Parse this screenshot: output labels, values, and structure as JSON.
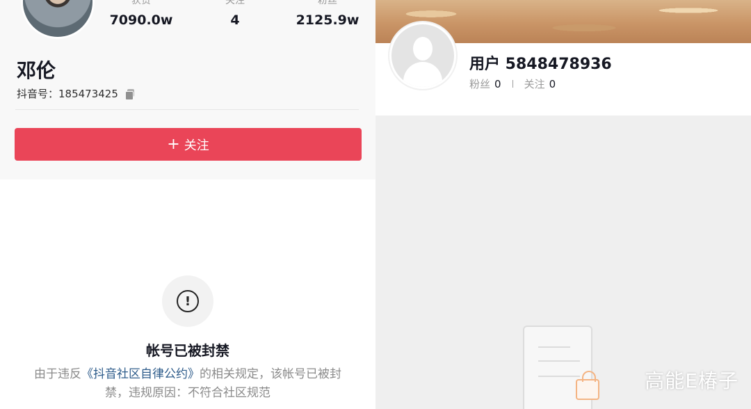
{
  "left": {
    "stats": [
      {
        "label": "获赞",
        "value": "7090.0w"
      },
      {
        "label": "关注",
        "value": "4"
      },
      {
        "label": "粉丝",
        "value": "2125.9w"
      }
    ],
    "name": "邓伦",
    "douyin_id": "抖音号：185473425",
    "follow_label": "关注",
    "follow_plus": "+",
    "ban_title": "帐号已被封禁",
    "ban_desc_prefix": "由于违反",
    "ban_desc_link": "《抖音社区自律公约》",
    "ban_desc_suffix": "的相关规定，该帐号已被封禁，违规原因：不符合社区规范",
    "ban_icon_glyph": "!"
  },
  "right": {
    "username": "用户 5848478936",
    "fans_label": "粉丝",
    "fans_value": "0",
    "following_label": "关注",
    "following_value": "0",
    "watermark": "高能E椿子"
  },
  "colors": {
    "follow_button": "#ea4558",
    "link": "#2d5b8a",
    "lock": "#f4b483"
  }
}
